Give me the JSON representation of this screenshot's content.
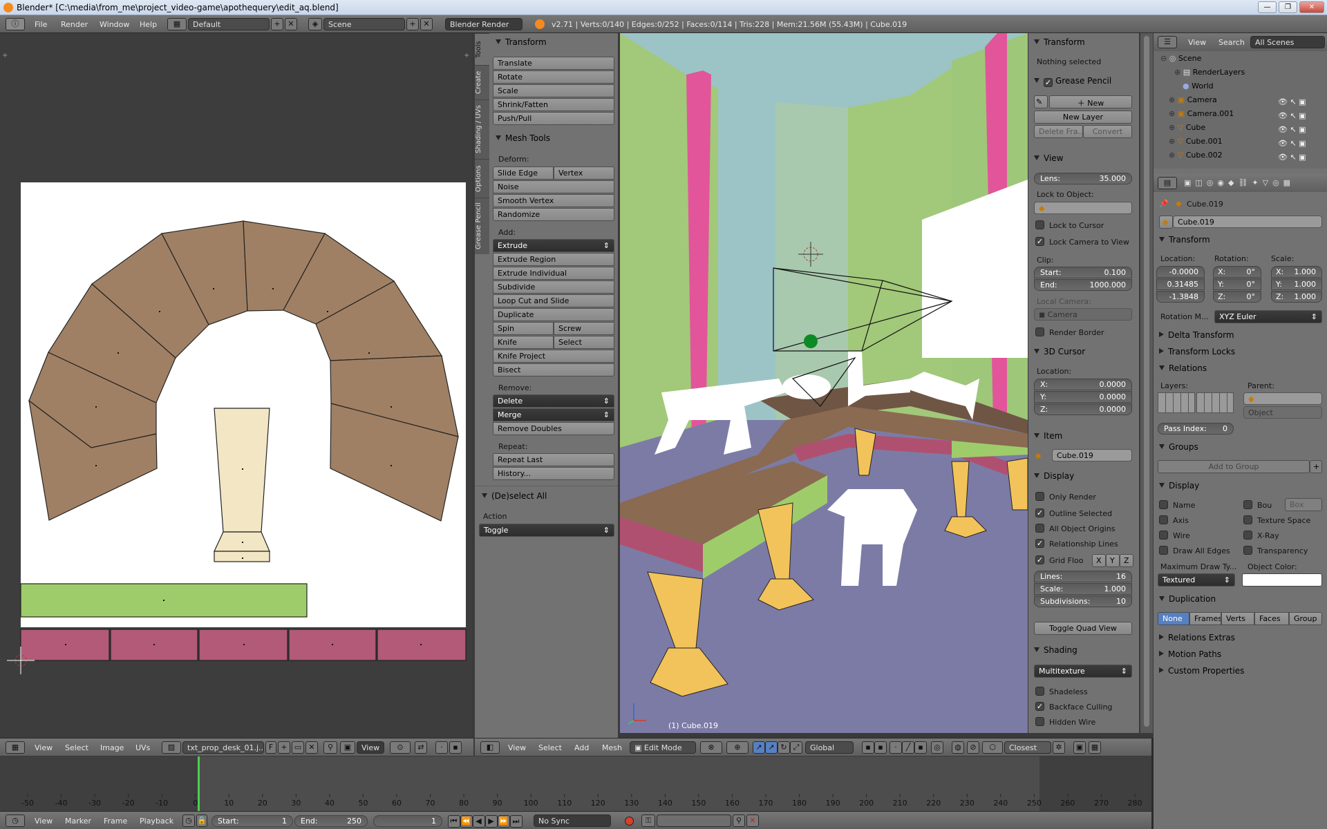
{
  "window": {
    "title": "Blender* [C:\\media\\from_me\\project_video-game\\apothequery\\edit_aq.blend]",
    "minimize": "—",
    "maximize": "❐",
    "close": "✕"
  },
  "info_header": {
    "menus": [
      "File",
      "Render",
      "Window",
      "Help"
    ],
    "layout": "Default",
    "scene": "Scene",
    "engine": "Blender Render",
    "stats": "v2.71 | Verts:0/140 | Edges:0/252 | Faces:0/114 | Tris:228 | Mem:21.56M (55.43M) | Cube.019"
  },
  "colors": {
    "uv_face_brown": "#a08064",
    "uv_face_cream": "#f2e6c4",
    "uv_face_green": "#9fcc6a",
    "uv_face_pink": "#b25a78",
    "wall_green": "#a2c87a",
    "wall_blue": "#9cc4c6",
    "wall_pink": "#e2559a",
    "floor_purple": "#7c7ba6",
    "desk_top_brown": "#8a6a50",
    "desk_leg_yellow": "#f2c35a",
    "accent_blue": "#5680c2"
  },
  "tool_tabs": [
    "Tools",
    "Create",
    "Shading / UVs",
    "Options",
    "Grease Pencil"
  ],
  "tools": {
    "transform_title": "Transform",
    "transform_buttons": [
      "Translate",
      "Rotate",
      "Scale",
      "Shrink/Fatten",
      "Push/Pull"
    ],
    "mesh_tools_title": "Mesh Tools",
    "deform_label": "Deform:",
    "slide_edge": "Slide Edge",
    "vertex": "Vertex",
    "noise": "Noise",
    "smooth_vertex": "Smooth Vertex",
    "randomize": "Randomize",
    "add_label": "Add:",
    "extrude": "Extrude",
    "extrude_region": "Extrude Region",
    "extrude_individual": "Extrude Individual",
    "subdivide": "Subdivide",
    "loop_cut": "Loop Cut and Slide",
    "duplicate": "Duplicate",
    "spin": "Spin",
    "screw": "Screw",
    "knife": "Knife",
    "select": "Select",
    "knife_project": "Knife Project",
    "bisect": "Bisect",
    "remove_label": "Remove:",
    "delete": "Delete",
    "merge": "Merge",
    "remove_doubles": "Remove Doubles",
    "repeat_label": "Repeat:",
    "repeat_last": "Repeat Last",
    "history": "History...",
    "deselect_title": "(De)select All",
    "action_label": "Action",
    "action_value": "Toggle"
  },
  "viewport": {
    "object_label": "(1) Cube.019"
  },
  "npanel": {
    "transform_title": "Transform",
    "nothing_selected": "Nothing selected",
    "grease_pencil_title": "Grease Pencil",
    "new": "New",
    "new_layer": "New Layer",
    "delete_frame": "Delete Fra...",
    "convert": "Convert",
    "view_title": "View",
    "lens_label": "Lens:",
    "lens_value": "35.000",
    "lock_to_object": "Lock to Object:",
    "lock_to_cursor": "Lock to Cursor",
    "lock_camera_to_view": "Lock Camera to View",
    "clip_label": "Clip:",
    "clip_start_label": "Start:",
    "clip_start": "0.100",
    "clip_end_label": "End:",
    "clip_end": "1000.000",
    "local_camera": "Local Camera:",
    "camera": "Camera",
    "render_border": "Render Border",
    "cursor_title": "3D Cursor",
    "location_label": "Location:",
    "cx_label": "X:",
    "cx": "0.0000",
    "cy_label": "Y:",
    "cy": "0.0000",
    "cz_label": "Z:",
    "cz": "0.0000",
    "item_title": "Item",
    "item_name": "Cube.019",
    "display_title": "Display",
    "only_render": "Only Render",
    "outline_selected": "Outline Selected",
    "all_object_origins": "All Object Origins",
    "relationship_lines": "Relationship Lines",
    "grid_floor": "Grid Floo",
    "gx": "X",
    "gy": "Y",
    "gz": "Z",
    "lines_label": "Lines:",
    "lines": "16",
    "scale_label": "Scale:",
    "scale": "1.000",
    "subdiv_label": "Subdivisions:",
    "subdiv": "10",
    "toggle_quad_view": "Toggle Quad View",
    "shading_title": "Shading",
    "shading_mode": "Multitexture",
    "shadeless": "Shadeless",
    "backface_culling": "Backface Culling",
    "hidden_wire": "Hidden Wire"
  },
  "outliner": {
    "view": "View",
    "search": "Search",
    "filter": "All Scenes",
    "items": [
      "Scene",
      "RenderLayers",
      "World",
      "Camera",
      "Camera.001",
      "Cube",
      "Cube.001",
      "Cube.002"
    ]
  },
  "properties": {
    "object_name": "Cube.019",
    "object_field": "Cube.019",
    "transform_title": "Transform",
    "location_label": "Location:",
    "rotation_label": "Rotation:",
    "scale_label": "Scale:",
    "loc": [
      "-0.0000",
      "0.31485",
      "-1.3848"
    ],
    "rot_labels": [
      "X:",
      "Y:",
      "Z:"
    ],
    "rot": [
      "0°",
      "0°",
      "0°"
    ],
    "scale_labels": [
      "X:",
      "Y:",
      "Z:"
    ],
    "scl": [
      "1.000",
      "1.000",
      "1.000"
    ],
    "rotation_mode_label": "Rotation M...",
    "rotation_mode": "XYZ Euler",
    "delta_transform": "Delta Transform",
    "transform_locks": "Transform Locks",
    "relations_title": "Relations",
    "layers_label": "Layers:",
    "parent_label": "Parent:",
    "parent_type": "Object",
    "pass_index_label": "Pass Index:",
    "pass_index": "0",
    "groups_title": "Groups",
    "add_to_group": "Add to Group",
    "display_title": "Display",
    "name": "Name",
    "bou": "Bou",
    "box": "Box",
    "axis": "Axis",
    "texture_space": "Texture Space",
    "wire": "Wire",
    "xray": "X-Ray",
    "draw_all_edges": "Draw All Edges",
    "transparency": "Transparency",
    "max_draw_type": "Maximum Draw Ty...",
    "object_color": "Object Color:",
    "draw_type": "Textured",
    "duplication_title": "Duplication",
    "dup_options": [
      "None",
      "Frames",
      "Verts",
      "Faces",
      "Group"
    ],
    "relations_extras": "Relations Extras",
    "motion_paths": "Motion Paths",
    "custom_properties": "Custom Properties"
  },
  "uv_header": {
    "menus": [
      "View",
      "Select",
      "Image",
      "UVs"
    ],
    "image": "txt_prop_desk_01.j...",
    "f": "F",
    "view": "View"
  },
  "view3d_header": {
    "menus": [
      "View",
      "Select",
      "Add",
      "Mesh"
    ],
    "mode": "Edit Mode",
    "orientation": "Global",
    "snap": "Closest"
  },
  "timeline": {
    "ticks": [
      "-50",
      "-40",
      "-30",
      "-20",
      "-10",
      "0",
      "10",
      "20",
      "30",
      "40",
      "50",
      "60",
      "70",
      "80",
      "90",
      "100",
      "110",
      "120",
      "130",
      "140",
      "150",
      "160",
      "170",
      "180",
      "190",
      "200",
      "210",
      "220",
      "230",
      "240",
      "250",
      "260",
      "270",
      "280"
    ],
    "current_frame": "1",
    "start_label": "Start:",
    "start": "1",
    "end_label": "End:",
    "end": "250",
    "frame": "1",
    "menus": [
      "View",
      "Marker",
      "Frame",
      "Playback"
    ],
    "sync": "No Sync"
  }
}
